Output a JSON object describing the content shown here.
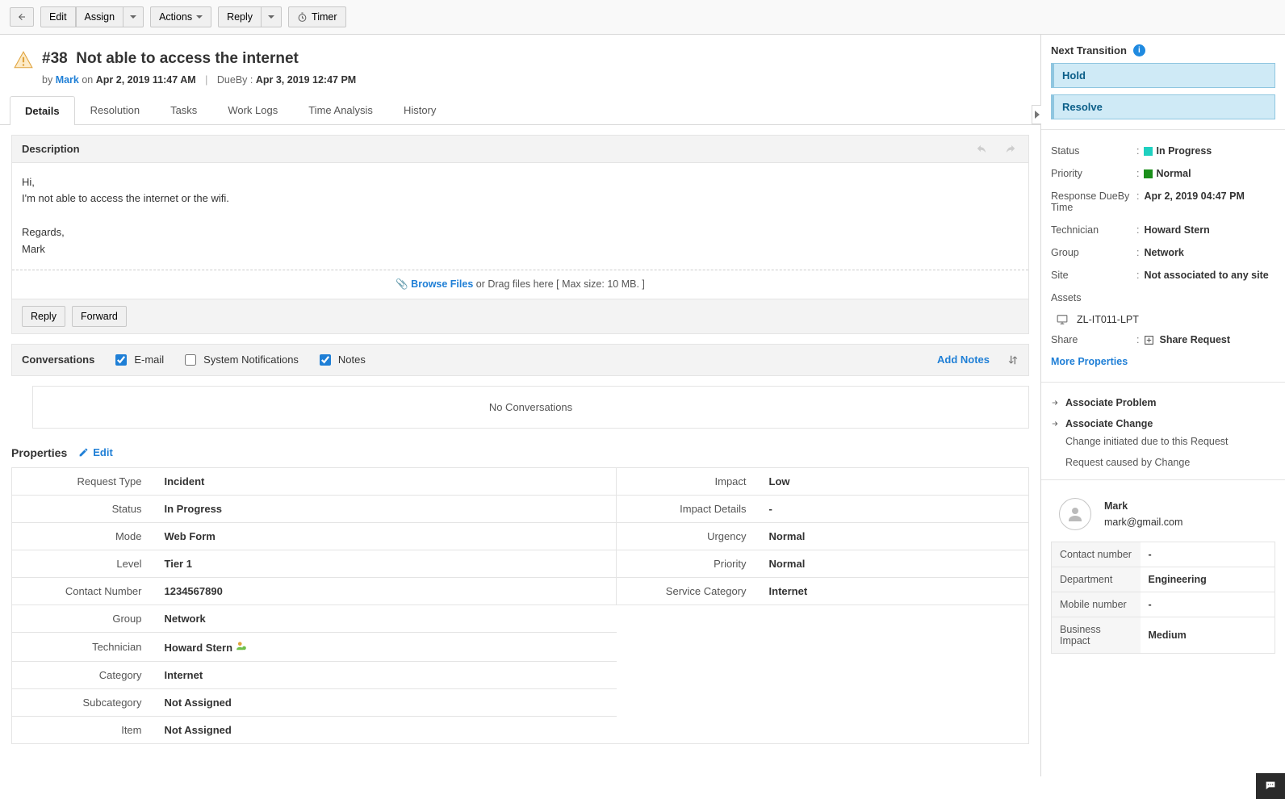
{
  "toolbar": {
    "edit": "Edit",
    "assign": "Assign",
    "actions": "Actions",
    "reply": "Reply",
    "timer": "Timer"
  },
  "ticket": {
    "id_prefix": "#38",
    "title": "Not able to access the internet",
    "by_label": "by",
    "author": "Mark",
    "on_label": "on",
    "created": "Apr 2, 2019 11:47 AM",
    "dueby_label": "DueBy :",
    "dueby": "Apr 3, 2019 12:47 PM"
  },
  "tabs": {
    "details": "Details",
    "resolution": "Resolution",
    "tasks": "Tasks",
    "worklogs": "Work Logs",
    "time": "Time Analysis",
    "history": "History"
  },
  "desc": {
    "heading": "Description",
    "l1": "Hi,",
    "l2": "I'm not able to access the internet or the wifi.",
    "l3": "Regards,",
    "l4": "Mark",
    "browse": "Browse Files",
    "drag": " or Drag files here [ Max size: 10 MB. ]",
    "reply": "Reply",
    "forward": "Forward"
  },
  "conv": {
    "title": "Conversations",
    "email": "E-mail",
    "sys": "System Notifications",
    "notes": "Notes",
    "add": "Add Notes",
    "empty": "No Conversations"
  },
  "props": {
    "title": "Properties",
    "edit": "Edit",
    "left": [
      {
        "k": "Request Type",
        "v": "Incident"
      },
      {
        "k": "Status",
        "v": "In Progress"
      },
      {
        "k": "Mode",
        "v": "Web Form"
      },
      {
        "k": "Level",
        "v": "Tier 1"
      },
      {
        "k": "Contact Number",
        "v": "1234567890"
      },
      {
        "k": "Group",
        "v": "Network"
      },
      {
        "k": "Technician",
        "v": "Howard Stern"
      },
      {
        "k": "Category",
        "v": "Internet"
      },
      {
        "k": "Subcategory",
        "v": "Not Assigned"
      },
      {
        "k": "Item",
        "v": "Not Assigned"
      }
    ],
    "right": [
      {
        "k": "Impact",
        "v": "Low"
      },
      {
        "k": "Impact Details",
        "v": "-"
      },
      {
        "k": "Urgency",
        "v": "Normal"
      },
      {
        "k": "Priority",
        "v": "Normal"
      },
      {
        "k": "Service Category",
        "v": "Internet"
      }
    ]
  },
  "side": {
    "nextTransition": "Next Transition",
    "hold": "Hold",
    "resolve": "Resolve",
    "status_k": "Status",
    "status_v": "In Progress",
    "status_color": "#1fd0c0",
    "priority_k": "Priority",
    "priority_v": "Normal",
    "priority_color": "#1a8f1a",
    "respdue_k": "Response DueBy Time",
    "respdue_v": "Apr 2, 2019 04:47 PM",
    "tech_k": "Technician",
    "tech_v": "Howard Stern",
    "group_k": "Group",
    "group_v": "Network",
    "site_k": "Site",
    "site_v": "Not associated to any site",
    "assets_k": "Assets",
    "asset_v": "ZL-IT011-LPT",
    "share_k": "Share",
    "share_v": "Share Request",
    "more": "More Properties",
    "assocProblem": "Associate Problem",
    "assocChange": "Associate Change",
    "changeSub1": "Change initiated due to this Request",
    "changeSub2": "Request caused by Change",
    "user_name": "Mark",
    "user_email": "mark@gmail.com",
    "contact": [
      {
        "k": "Contact number",
        "v": "-"
      },
      {
        "k": "Department",
        "v": "Engineering"
      },
      {
        "k": "Mobile number",
        "v": "-"
      },
      {
        "k": "Business Impact",
        "v": "Medium"
      }
    ]
  }
}
